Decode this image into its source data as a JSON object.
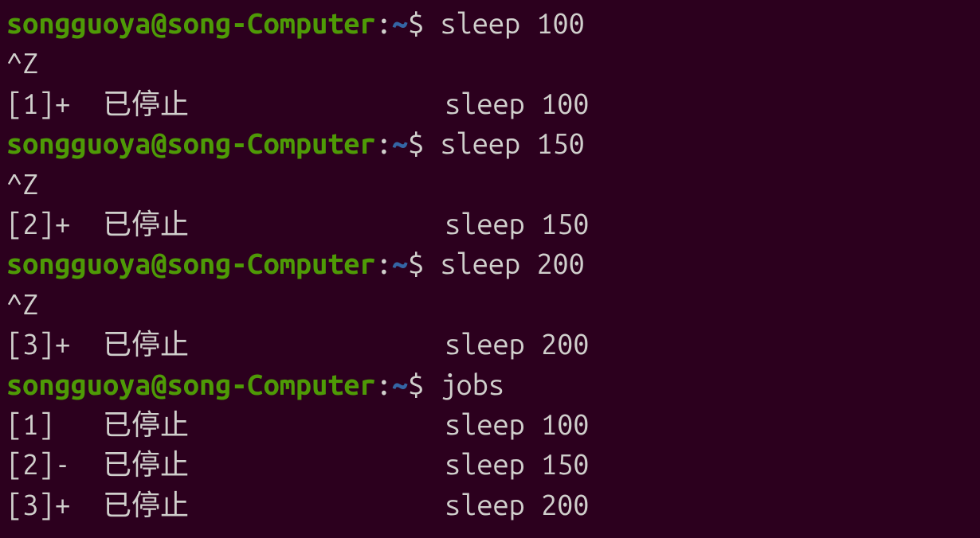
{
  "prompt": {
    "user": "songguoya",
    "at": "@",
    "host": "song-Computer",
    "colon": ":",
    "path": "~",
    "dollar": "$"
  },
  "session": [
    {
      "type": "cmd",
      "command": "sleep 100"
    },
    {
      "type": "out",
      "text": "^Z"
    },
    {
      "type": "job",
      "left": "[1]+  已停止",
      "right": "sleep 100"
    },
    {
      "type": "cmd",
      "command": "sleep 150"
    },
    {
      "type": "out",
      "text": "^Z"
    },
    {
      "type": "job",
      "left": "[2]+  已停止",
      "right": "sleep 150"
    },
    {
      "type": "cmd",
      "command": "sleep 200"
    },
    {
      "type": "out",
      "text": "^Z"
    },
    {
      "type": "job",
      "left": "[3]+  已停止",
      "right": "sleep 200"
    },
    {
      "type": "cmd",
      "command": "jobs"
    },
    {
      "type": "job",
      "left": "[1]   已停止",
      "right": "sleep 100"
    },
    {
      "type": "job",
      "left": "[2]-  已停止",
      "right": "sleep 150"
    },
    {
      "type": "job",
      "left": "[3]+  已停止",
      "right": "sleep 200"
    }
  ]
}
